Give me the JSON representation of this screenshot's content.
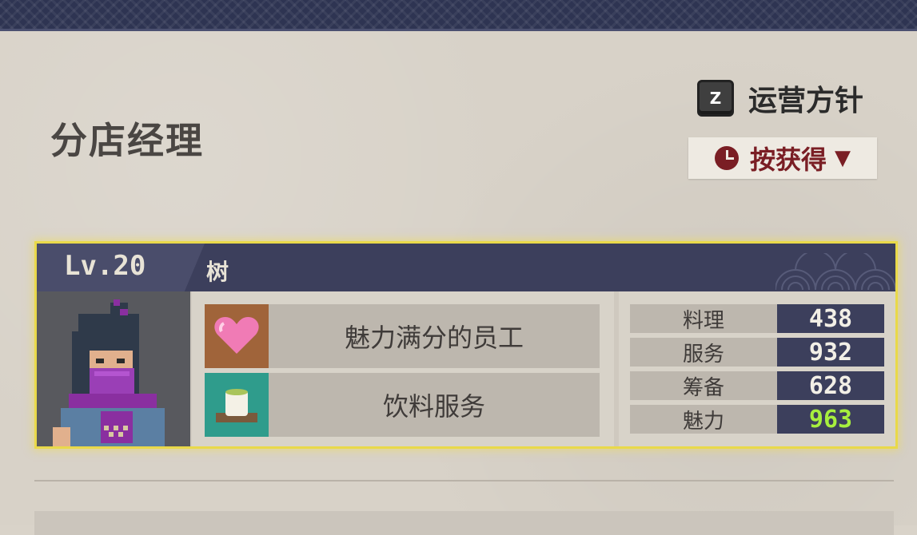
{
  "page": {
    "title": "分店经理"
  },
  "policy": {
    "key": "Z",
    "label": "运营方针"
  },
  "sort": {
    "label": "按获得",
    "caret": "▼",
    "icon": "clock-icon"
  },
  "employee": {
    "level": "Lv.20",
    "name": "树",
    "skills": [
      {
        "label": "魅力满分的员工",
        "icon": "heart-icon"
      },
      {
        "label": "饮料服务",
        "icon": "tea-cup-icon"
      }
    ],
    "stats": [
      {
        "label": "料理",
        "value": "438",
        "highlight": false
      },
      {
        "label": "服务",
        "value": "932",
        "highlight": false
      },
      {
        "label": "筹备",
        "value": "628",
        "highlight": false
      },
      {
        "label": "魅力",
        "value": "963",
        "highlight": true
      }
    ]
  },
  "colors": {
    "highlight_stat": "#a7ef3e",
    "card_border": "#e9d94a",
    "header_navy": "#3c3f5c"
  }
}
